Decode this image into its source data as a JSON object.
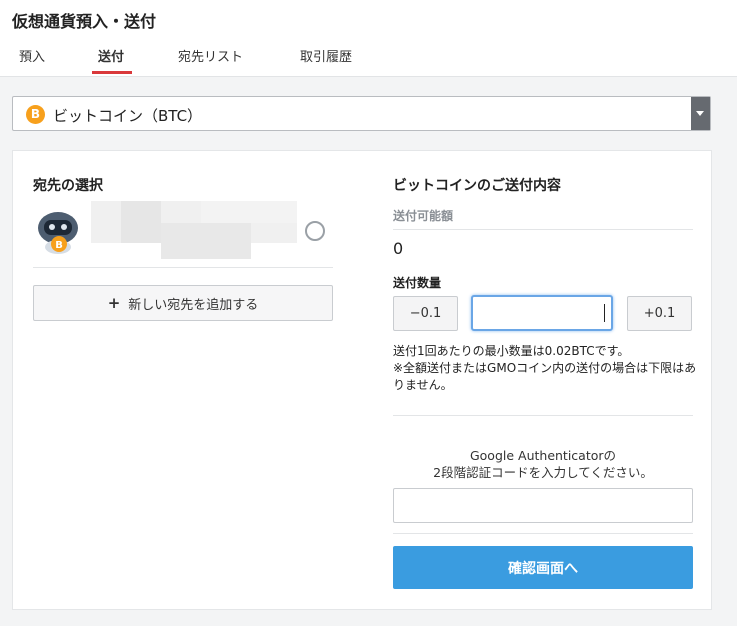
{
  "header": {
    "title": "仮想通貨預入・送付",
    "tabs": [
      {
        "label": "預入",
        "active": false
      },
      {
        "label": "送付",
        "active": true
      },
      {
        "label": "宛先リスト",
        "active": false
      },
      {
        "label": "取引履歴",
        "active": false
      }
    ],
    "active_color": "#d9383a"
  },
  "currency_select": {
    "icon": "bitcoin-icon",
    "icon_glyph": "B",
    "selected": "ビットコイン（BTC）"
  },
  "destination": {
    "title": "宛先の選択",
    "add_button": {
      "icon_glyph": "+",
      "label": "新しい宛先を追加する"
    }
  },
  "send": {
    "title": "ビットコインのご送付内容",
    "available_label": "送付可能額",
    "available_value": "0",
    "quantity_label": "送付数量",
    "minus_label": "−0.1",
    "plus_label": "+0.1",
    "quantity_value": "",
    "note_line1": "送付1回あたりの最小数量は0.02BTCです。",
    "note_line2": "※全額送付またはGMOコイン内の送付の場合は下限はありません。",
    "auth_line1": "Google Authenticatorの",
    "auth_line2": "2段階認証コードを入力してください。",
    "auth_value": "",
    "confirm_label": "確認画面へ",
    "confirm_color": "#3a9ce0"
  }
}
